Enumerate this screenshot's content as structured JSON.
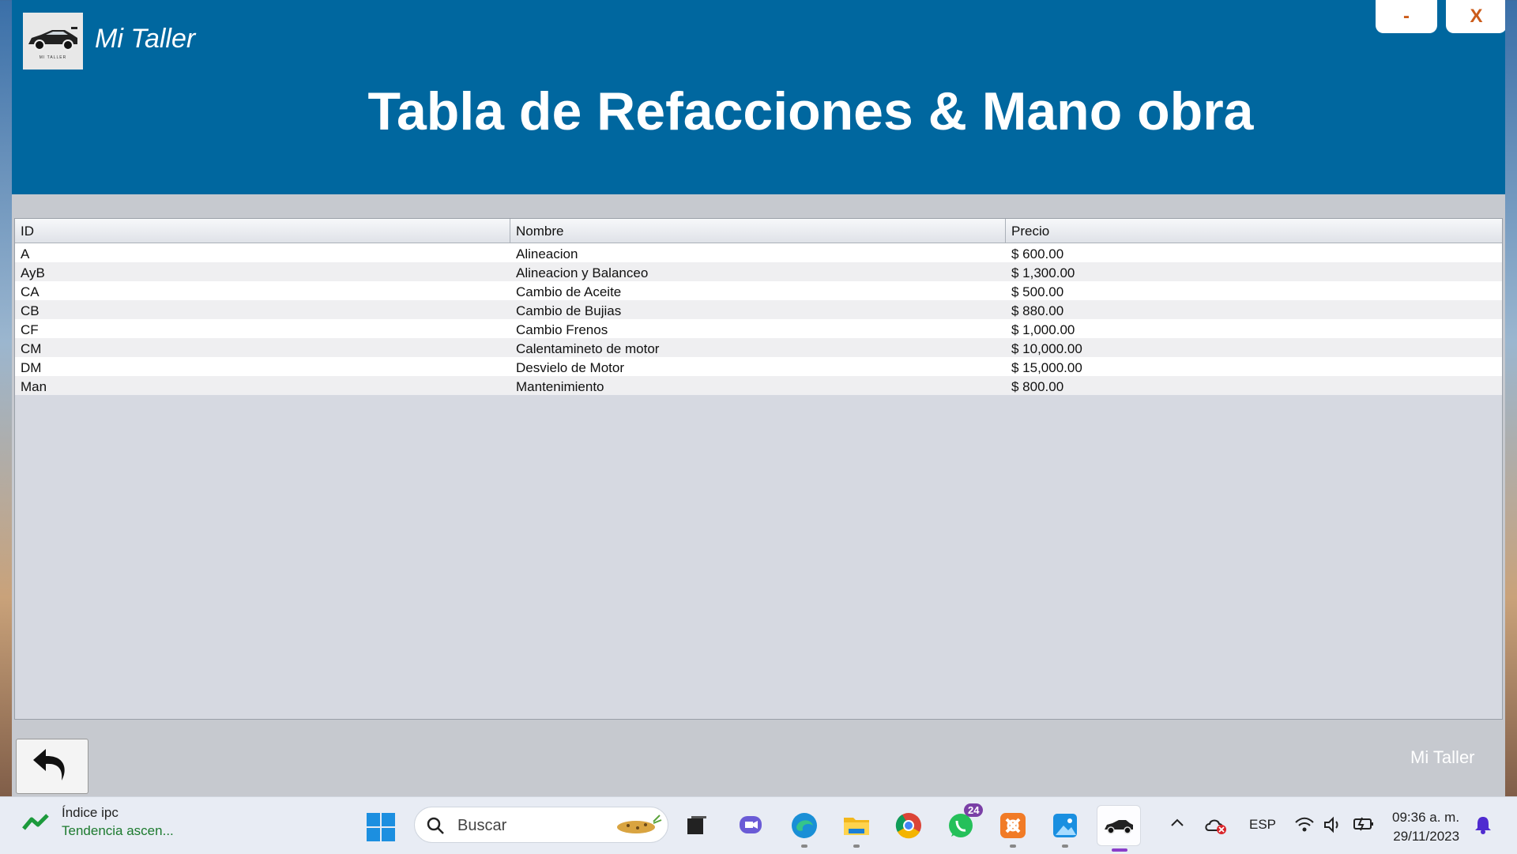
{
  "window": {
    "app_name": "Mi Taller",
    "logo_caption": "MI TALLER",
    "title": "Tabla de Refacciones & Mano obra",
    "minimize_label": "-",
    "close_label": "X"
  },
  "table": {
    "columns": [
      "ID",
      "Nombre",
      "Precio"
    ],
    "rows": [
      [
        "A",
        "Alineacion",
        "$ 600.00"
      ],
      [
        "AyB",
        "Alineacion y Balanceo",
        "$ 1,300.00"
      ],
      [
        "CA",
        "Cambio de Aceite",
        "$ 500.00"
      ],
      [
        "CB",
        "Cambio de Bujias",
        "$ 880.00"
      ],
      [
        "CF",
        "Cambio Frenos",
        "$ 1,000.00"
      ],
      [
        "CM",
        "Calentamineto de motor",
        "$ 10,000.00"
      ],
      [
        "DM",
        "Desvielo de Motor",
        "$ 15,000.00"
      ],
      [
        "Man",
        "Mantenimiento",
        "$ 800.00"
      ]
    ]
  },
  "footer": {
    "brand": "Mi Taller",
    "back_icon": "undo-arrow-icon"
  },
  "taskbar": {
    "weather_title": "Índice ipc",
    "weather_sub": "Tendencia ascen...",
    "search_placeholder": "Buscar",
    "whatsapp_badge": "24",
    "language": "ESP",
    "time": "09:36 a. m.",
    "date": "29/11/2023"
  },
  "colors": {
    "header": "#00679f",
    "window_button_text": "#cc5c1a",
    "body": "#c6c9cf"
  }
}
